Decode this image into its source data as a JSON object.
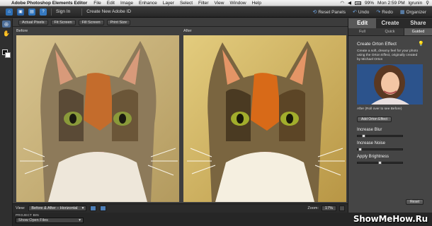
{
  "menubar": {
    "app_name": "Adobe Photoshop Elements Editor",
    "items": [
      "File",
      "Edit",
      "Image",
      "Enhance",
      "Layer",
      "Select",
      "Filter",
      "View",
      "Window",
      "Help"
    ],
    "battery": "99%",
    "clock": "Mon 2:59 PM",
    "user": "lgrunin"
  },
  "appbar": {
    "sign_in": "Sign In",
    "create_id": "Create New Adobe ID",
    "reset_panels": "Reset Panels",
    "undo": "Undo",
    "redo": "Redo",
    "organizer": "Organizer"
  },
  "viewbar": {
    "buttons": [
      "Actual Pixels",
      "Fit Screen",
      "Fill Screen",
      "Print Size"
    ]
  },
  "canvas": {
    "before_label": "Before",
    "after_label": "After"
  },
  "statusbar": {
    "view_label": "View:",
    "view_value": "Before & After – Horizontal",
    "zoom_label": "Zoom:",
    "zoom_value": "17%"
  },
  "project_bin": {
    "header": "PROJECT BIN",
    "dropdown": "Show Open Files"
  },
  "panel": {
    "tabs": [
      "Edit",
      "Create",
      "Share"
    ],
    "active_tab": "Edit",
    "subtabs": [
      "Full",
      "Quick",
      "Guided"
    ],
    "active_subtab": "Guided",
    "effect_title": "Create Orton Effect",
    "description": "Create a soft, dreamy feel for your photo using the Orton Effect, originally created by Michael Orton",
    "caption": "After (Roll over to see Before)",
    "add_button": "Add Orton Effect",
    "sliders": [
      {
        "label": "Increase Blur",
        "value": 0.1
      },
      {
        "label": "Increase Noise",
        "value": 0.02
      },
      {
        "label": "Apply Brightness",
        "value": 0.5
      }
    ],
    "reset_button": "Reset"
  },
  "watermark": "ShowMeHow.Ru",
  "colors": {
    "accent_blue": "#2d6fb5",
    "panel_bg": "#454545",
    "canvas_bg": "#3e3e3e"
  }
}
